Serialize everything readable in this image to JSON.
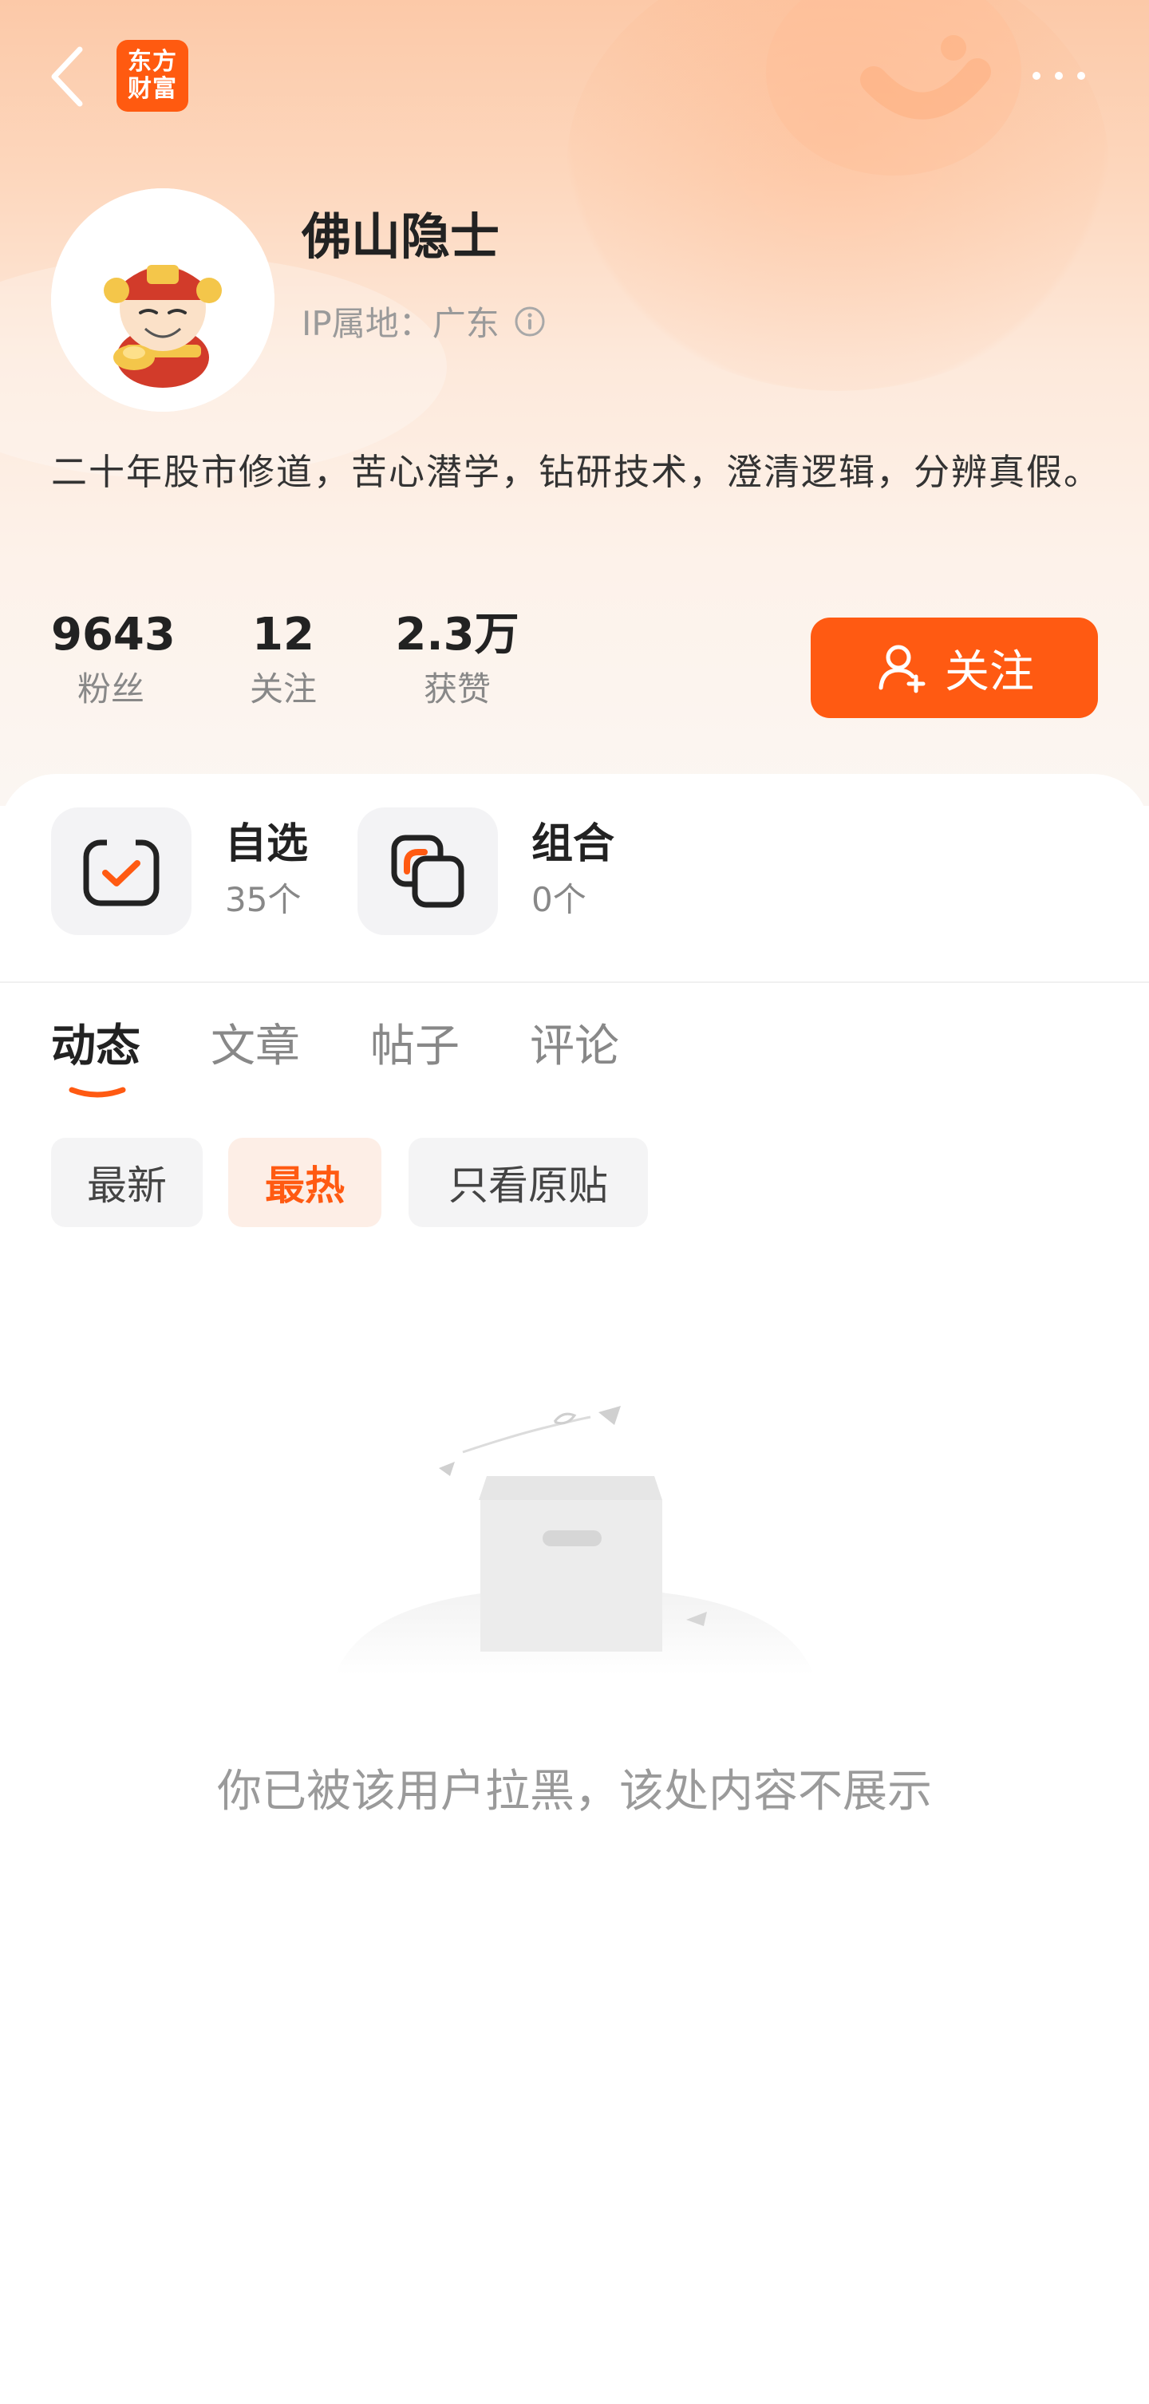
{
  "header": {
    "back_icon": "chevron-left-icon",
    "logo_text": "东方财富",
    "more_icon": "more-horizontal-icon"
  },
  "profile": {
    "name": "佛山隐士",
    "ip_location": "IP属地：广东",
    "bio": "二十年股市修道，苦心潜学，钻研技术，澄清逻辑，分辨真假。",
    "stats": [
      {
        "value": "9643",
        "label": "粉丝"
      },
      {
        "value": "12",
        "label": "关注"
      },
      {
        "value": "2.3万",
        "label": "获赞"
      }
    ],
    "follow_label": "关注"
  },
  "features": [
    {
      "title": "自选",
      "subtitle": "35个"
    },
    {
      "title": "组合",
      "subtitle": "0个"
    }
  ],
  "tabs": [
    "动态",
    "文章",
    "帖子",
    "评论"
  ],
  "active_tab": "动态",
  "filters": [
    "最新",
    "最热",
    "只看原贴"
  ],
  "active_filter": "最热",
  "empty_message": "你已被该用户拉黑，该处内容不展示",
  "colors": {
    "accent": "#ff5a12",
    "logo": "#ff5a10",
    "muted_text": "#9a9a9a",
    "chip_active_bg": "#fdeee6"
  }
}
